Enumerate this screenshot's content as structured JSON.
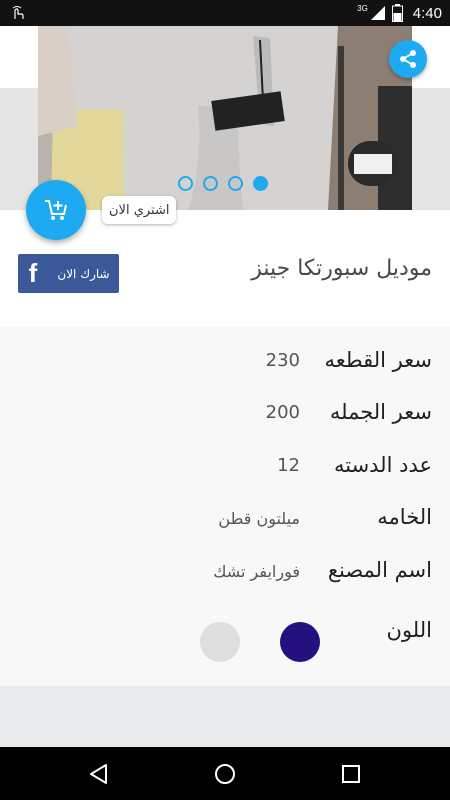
{
  "status_bar": {
    "network_label": "3G",
    "time": "4:40",
    "left_icon": "tapping-hand-icon",
    "icons": [
      "signal-icon",
      "battery-icon"
    ]
  },
  "header": {
    "close_icon": "close-icon",
    "share_icon": "share-icon",
    "slide_count": 4,
    "active_slide": 3
  },
  "actions": {
    "buy_now_label": "اشتري الان",
    "cart_icon": "add-to-cart-icon",
    "facebook_share_label": "شارك الان",
    "facebook_icon": "facebook-icon"
  },
  "product": {
    "title": "موديل سبورتكا جينز"
  },
  "details": {
    "piece_price": {
      "label": "سعر القطعه",
      "value": "230"
    },
    "wholesale_price": {
      "label": "سعر الجمله",
      "value": "200"
    },
    "dozen_count": {
      "label": "عدد الدسته",
      "value": "12"
    },
    "material": {
      "label": "الخامه",
      "value": "ميلتون قطن"
    },
    "factory": {
      "label": "اسم المصنع",
      "value": "فورايفر تشك"
    },
    "color": {
      "label": "اللون"
    }
  },
  "colors": {
    "accent": "#1eaaf1",
    "facebook": "#3b5998",
    "swatch_navy": "#24107e",
    "swatch_gray": "#dededf"
  },
  "nav": {
    "back_icon": "back-triangle-icon",
    "home_icon": "home-circle-icon",
    "recents_icon": "recents-square-icon"
  }
}
